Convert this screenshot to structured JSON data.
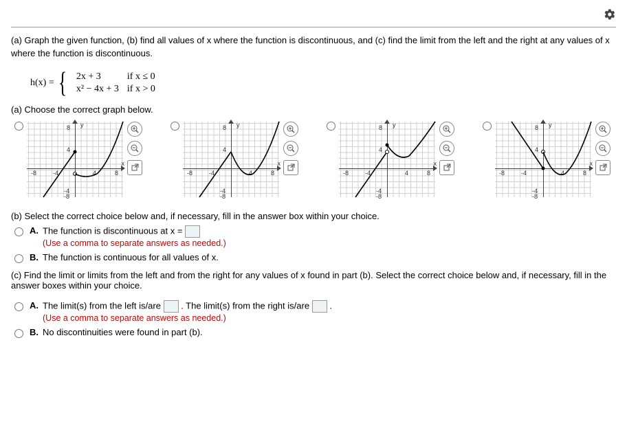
{
  "toolbar": {
    "gear": "settings-icon"
  },
  "prompt": "(a) Graph the given function, (b) find all values of x where the function is discontinuous, and (c) find the limit from the left and the right at any values of x where the function is discontinuous.",
  "equation": {
    "lhs": "h(x) =",
    "pieces": [
      {
        "expr": "2x + 3",
        "cond": "if x ≤ 0"
      },
      {
        "expr": "x² − 4x + 3",
        "cond": "if x > 0"
      }
    ]
  },
  "part_a": {
    "prompt": "(a) Choose the correct graph below.",
    "ticks": {
      "x": [
        "-8",
        "-4",
        "4",
        "8"
      ],
      "y": [
        "8",
        "4",
        "-4",
        "-8"
      ],
      "xlabel": "x",
      "ylabel": "y"
    },
    "zoom_in": "⊕",
    "zoom_out": "⊖",
    "open_ext": "⧉"
  },
  "part_b": {
    "prompt": "(b) Select the correct choice below and, if necessary, fill in the answer box within your choice.",
    "A_pre": "The function is discontinuous at x =",
    "A_hint": "(Use a comma to separate answers as needed.)",
    "B": "The function is continuous for all values of x.",
    "letter_A": "A.",
    "letter_B": "B."
  },
  "part_c": {
    "prompt": "(c) Find the limit or limits from the left and from the right for any values of x found in part (b). Select the correct choice below and, if necessary, fill in the answer boxes within your choice.",
    "A_pre": "The limit(s) from the left is/are",
    "A_mid": ". The limit(s) from the right is/are",
    "A_post": ".",
    "A_hint": "(Use a comma to separate answers as needed.)",
    "B": "No discontinuities were found in part (b).",
    "letter_A": "A.",
    "letter_B": "B."
  }
}
